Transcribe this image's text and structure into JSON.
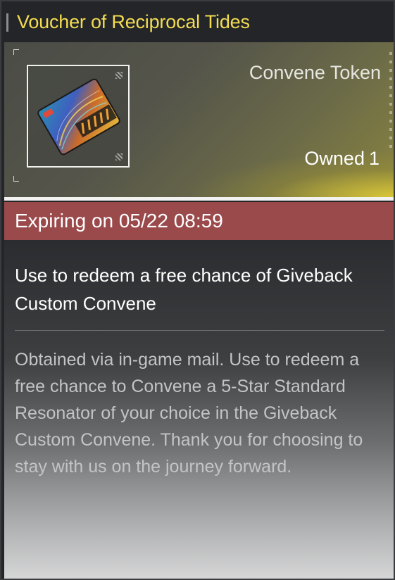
{
  "item": {
    "name": "Voucher of Reciprocal Tides",
    "category": "Convene Token",
    "owned_label": "Owned",
    "owned_count": "1",
    "icon": "voucher-ticket-icon"
  },
  "expiry": {
    "text": "Expiring on 05/22 08:59"
  },
  "summary": "Use to redeem a free chance of Giveback Custom Convene",
  "description": "Obtained via in-game mail. Use to redeem a free chance to Convene a 5-Star Standard Resonator of your choice in the Giveback Custom Convene. Thank you for choosing to stay with us on the journey forward.",
  "colors": {
    "title": "#f3dc52",
    "expire_bar": "#9b4a4c",
    "header_glow": "#e1cd37"
  }
}
